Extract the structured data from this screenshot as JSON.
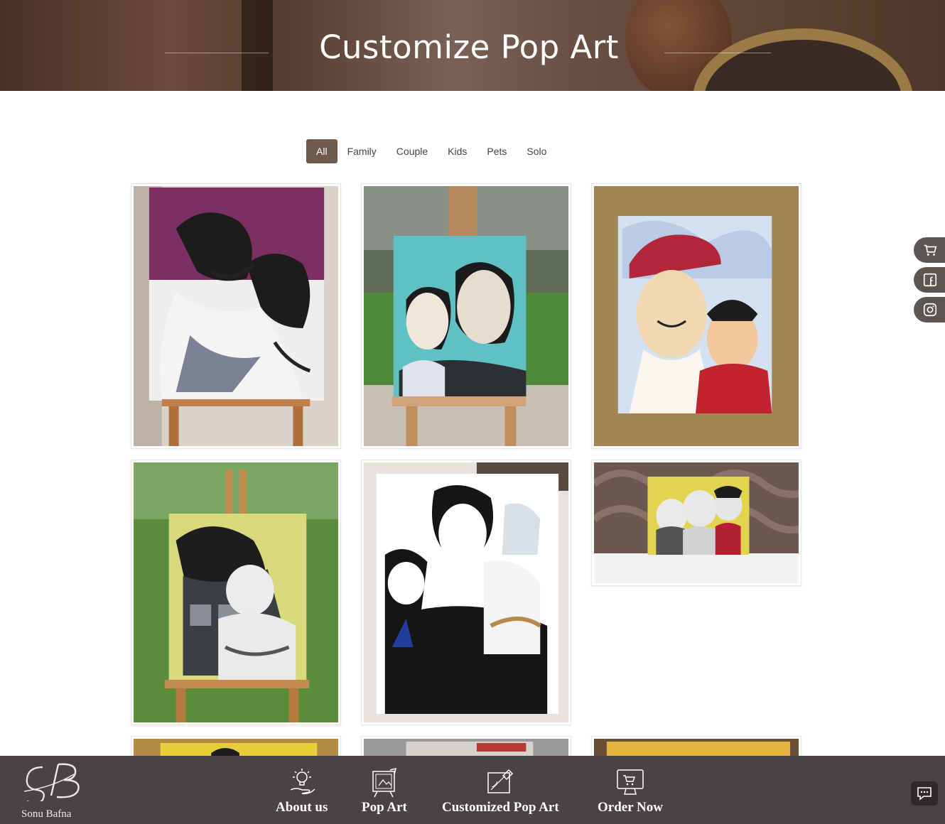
{
  "hero": {
    "title": "Customize Pop Art"
  },
  "filters": {
    "items": [
      "All",
      "Family",
      "Couple",
      "Kids",
      "Pets",
      "Solo"
    ],
    "active": "All"
  },
  "gallery": {
    "items": [
      {
        "icon": "pop-art-couple-painting"
      },
      {
        "icon": "pop-art-father-son-painting"
      },
      {
        "icon": "pop-art-grandfather-grandson-painting"
      },
      {
        "icon": "pop-art-parent-baby-painting"
      },
      {
        "icon": "pop-art-family-painting"
      },
      {
        "icon": "pop-art-family-three-painting"
      },
      {
        "icon": "pop-art-painting"
      },
      {
        "icon": "pop-art-painting"
      },
      {
        "icon": "pop-art-painting"
      }
    ]
  },
  "side_social": [
    {
      "icon": "cart-icon"
    },
    {
      "icon": "facebook-icon"
    },
    {
      "icon": "instagram-icon"
    }
  ],
  "bottom_bar": {
    "logo_name": "Sonu Bafna",
    "nav": [
      {
        "label": "About us",
        "icon": "lightbulb-hand-icon"
      },
      {
        "label": "Pop Art",
        "icon": "canvas-icon"
      },
      {
        "label": "Customized Pop Art",
        "icon": "canvas-edit-icon"
      },
      {
        "label": "Order Now",
        "icon": "monitor-cart-icon"
      }
    ],
    "chat_icon": "chat-icon"
  },
  "colors": {
    "accent": "#6e5a4d",
    "bar": "#494443",
    "side": "#5b5554"
  }
}
